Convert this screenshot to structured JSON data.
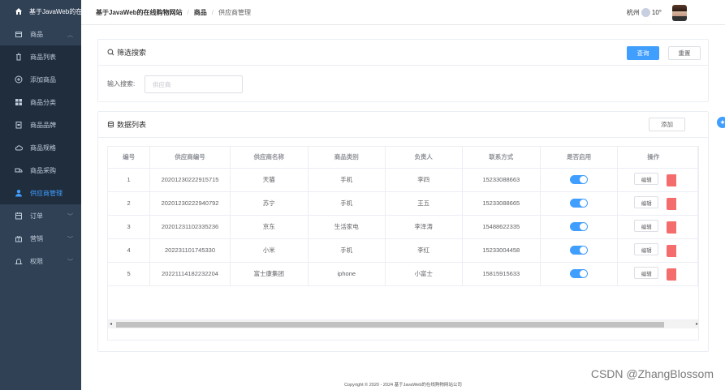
{
  "sidebar": {
    "logo_text": "基于JavaWeb的在",
    "items": [
      {
        "label": "商品",
        "icon": "cube-icon"
      },
      {
        "label": "商品列表",
        "icon": "trash-icon"
      },
      {
        "label": "添加商品",
        "icon": "plus-circle-icon"
      },
      {
        "label": "商品分类",
        "icon": "grid-icon"
      },
      {
        "label": "商品品牌",
        "icon": "clipboard-icon"
      },
      {
        "label": "商品规格",
        "icon": "cloud-icon"
      },
      {
        "label": "商品采购",
        "icon": "truck-icon"
      },
      {
        "label": "供应商管理",
        "icon": "user-icon"
      },
      {
        "label": "订单",
        "icon": "calendar-icon"
      },
      {
        "label": "营销",
        "icon": "gift-icon"
      },
      {
        "label": "权限",
        "icon": "bell-icon"
      }
    ]
  },
  "header": {
    "breadcrumb": [
      "基于JavaWeb的在线购物网站",
      "商品",
      "供应商管理"
    ],
    "city": "杭州",
    "temperature": "10°"
  },
  "search": {
    "title": "筛选搜索",
    "query_label": "查询",
    "reset_label": "重置",
    "input_label": "输入搜索:",
    "input_placeholder": "供应商"
  },
  "list": {
    "title": "数据列表",
    "add_label": "添加",
    "columns": [
      "编号",
      "供应商编号",
      "供应商名称",
      "商品类别",
      "负责人",
      "联系方式",
      "是否启用",
      "操作"
    ],
    "rows": [
      [
        "1",
        "20201230222915715",
        "天猫",
        "手机",
        "李四",
        "15233088663"
      ],
      [
        "2",
        "20201230222940792",
        "苏宁",
        "手机",
        "王五",
        "15233088665"
      ],
      [
        "3",
        "20201231102335236",
        "京东",
        "生活家电",
        "李泽涛",
        "15488622335"
      ],
      [
        "4",
        "202231101745330",
        "小米",
        "手机",
        "李红",
        "15233004458"
      ],
      [
        "5",
        "20221114182232204",
        "富士康集团",
        "iphone",
        "小富士",
        "15815915633"
      ]
    ],
    "edit_label": "编辑",
    "enabled": [
      true,
      true,
      true,
      true,
      true
    ]
  },
  "footer": "Copyright © 2020 - 2024  基于JavaWeb的在线购物网站公司",
  "watermark": "CSDN @ZhangBlossom",
  "colors": {
    "primary": "#409eff",
    "sidebar_bg": "#304156",
    "danger": "#f56c6c"
  }
}
